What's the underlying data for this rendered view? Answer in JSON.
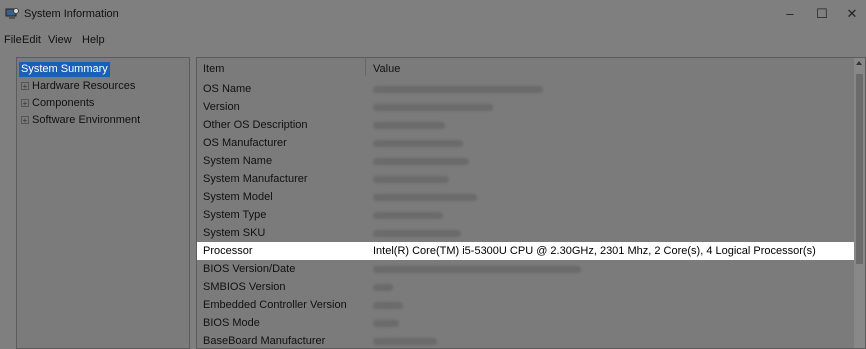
{
  "window": {
    "title": "System Information",
    "minimize": "–",
    "maximize": "☐",
    "close": "✕"
  },
  "menu": [
    "File",
    "Edit",
    "View",
    "Help"
  ],
  "tree": {
    "selected": "System Summary",
    "nodes": [
      "Hardware Resources",
      "Components",
      "Software Environment"
    ],
    "expander": "+"
  },
  "list": {
    "columns": {
      "item": "Item",
      "value": "Value"
    },
    "rows": [
      {
        "item": "OS Name",
        "value": ""
      },
      {
        "item": "Version",
        "value": ""
      },
      {
        "item": "Other OS Description",
        "value": ""
      },
      {
        "item": "OS Manufacturer",
        "value": ""
      },
      {
        "item": "System Name",
        "value": ""
      },
      {
        "item": "System Manufacturer",
        "value": ""
      },
      {
        "item": "System Model",
        "value": ""
      },
      {
        "item": "System Type",
        "value": ""
      },
      {
        "item": "System SKU",
        "value": ""
      },
      {
        "item": "Processor",
        "value": "Intel(R) Core(TM) i5-5300U CPU @ 2.30GHz, 2301 Mhz, 2 Core(s), 4 Logical Processor(s)"
      },
      {
        "item": "BIOS Version/Date",
        "value": ""
      },
      {
        "item": "SMBIOS Version",
        "value": ""
      },
      {
        "item": "Embedded Controller Version",
        "value": ""
      },
      {
        "item": "BIOS Mode",
        "value": ""
      },
      {
        "item": "BaseBoard Manufacturer",
        "value": ""
      }
    ]
  },
  "colors": {
    "selection": "#1c5fb8",
    "highlight_row": "#ffffff",
    "dim_background": "#7f7f7f"
  }
}
